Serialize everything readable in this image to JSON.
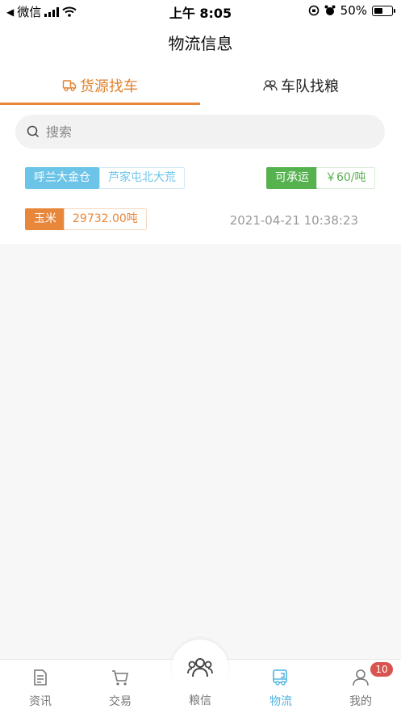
{
  "status_bar": {
    "back_app": "微信",
    "time": "上午 8:05",
    "battery": "50%"
  },
  "page": {
    "title": "物流信息"
  },
  "tabs": [
    {
      "label": "货源找车",
      "active": true
    },
    {
      "label": "车队找粮",
      "active": false
    }
  ],
  "search": {
    "placeholder": "搜索",
    "value": ""
  },
  "listing": {
    "origin": "呼兰大金仓",
    "destination": "芦家屯北大荒",
    "status": "可承运",
    "price": "￥60/吨",
    "goods": "玉米",
    "weight": "29732.00吨",
    "datetime": "2021-04-21 10:38:23"
  },
  "bottom_nav": {
    "items": [
      {
        "label": "资讯",
        "icon": "news-icon"
      },
      {
        "label": "交易",
        "icon": "cart-icon"
      },
      {
        "label": "粮信",
        "icon": "group-icon"
      },
      {
        "label": "物流",
        "icon": "truck-icon",
        "active": true
      },
      {
        "label": "我的",
        "icon": "user-icon"
      }
    ],
    "badge": "10"
  },
  "colors": {
    "accent_orange": "#e8863a",
    "accent_blue": "#6cc4e8",
    "accent_green": "#56b24e",
    "badge_red": "#d9534f"
  }
}
